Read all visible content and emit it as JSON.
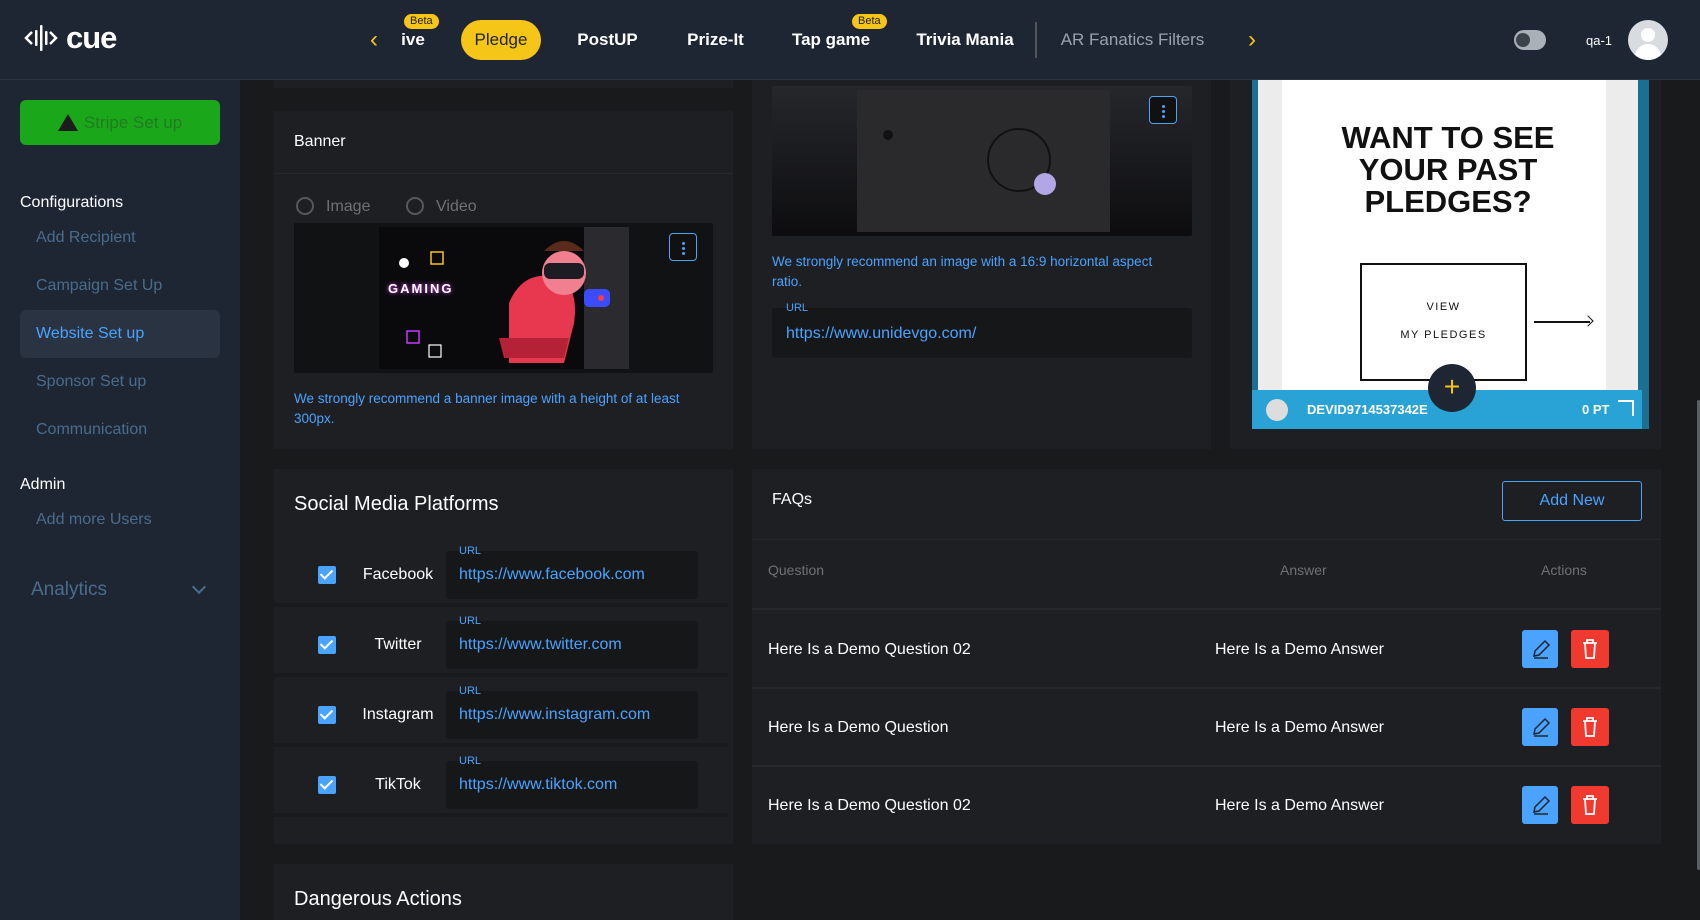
{
  "app": {
    "logo_text": "cue"
  },
  "topnav": {
    "tabs": [
      {
        "label": "ive",
        "beta": "Beta"
      },
      {
        "label": "Pledge",
        "active": true
      },
      {
        "label": "PostUP"
      },
      {
        "label": "Prize-It"
      },
      {
        "label": "Tap game",
        "beta": "Beta"
      },
      {
        "label": "Trivia Mania"
      },
      {
        "label": "AR Fanatics Filters"
      }
    ],
    "username": "qa-1"
  },
  "sidebar": {
    "stripe_button": "Stripe Set up",
    "configurations_heading": "Configurations",
    "config_items": [
      "Add Recipient",
      "Campaign Set Up",
      "Website Set up",
      "Sponsor Set up",
      "Communication"
    ],
    "admin_heading": "Admin",
    "admin_items": [
      "Add more Users"
    ],
    "analytics_label": "Analytics"
  },
  "banner": {
    "title": "Banner",
    "radio_image": "Image",
    "radio_video": "Video",
    "gaming_text": "GAMING",
    "hint": "We strongly recommend a banner image with a height of at least 300px."
  },
  "media2": {
    "hint": "We strongly recommend an image with a 16:9 horizontal aspect ratio.",
    "url_label": "URL",
    "url_value": "https://www.unidevgo.com/"
  },
  "preview": {
    "headline_1": "WANT TO SEE",
    "headline_2": "YOUR PAST",
    "headline_3": "PLEDGES?",
    "view_label": "VIEW",
    "my_pledges_label": "MY PLEDGES",
    "device_id": "DEVID9714537342E",
    "points": "0 PT"
  },
  "social": {
    "title": "Social Media Platforms",
    "url_label": "URL",
    "platforms": [
      {
        "name": "Facebook",
        "url": "https://www.facebook.com"
      },
      {
        "name": "Twitter",
        "url": "https://www.twitter.com"
      },
      {
        "name": "Instagram",
        "url": "https://www.instagram.com"
      },
      {
        "name": "TikTok",
        "url": "https://www.tiktok.com"
      }
    ]
  },
  "faqs": {
    "title": "FAQs",
    "add_new": "Add New",
    "headers": {
      "question": "Question",
      "answer": "Answer",
      "actions": "Actions"
    },
    "rows": [
      {
        "question": "Here Is a Demo Question 02",
        "answer": "Here Is a Demo Answer"
      },
      {
        "question": "Here Is a Demo Question",
        "answer": "Here Is a Demo Answer"
      },
      {
        "question": "Here Is a Demo Question 02",
        "answer": "Here Is a Demo Answer"
      }
    ]
  },
  "danger": {
    "title": "Dangerous Actions"
  },
  "colors": {
    "accent": "#4aa3ff",
    "brand_yellow": "#f5c518",
    "danger": "#f03a30",
    "success": "#1aa81a"
  }
}
